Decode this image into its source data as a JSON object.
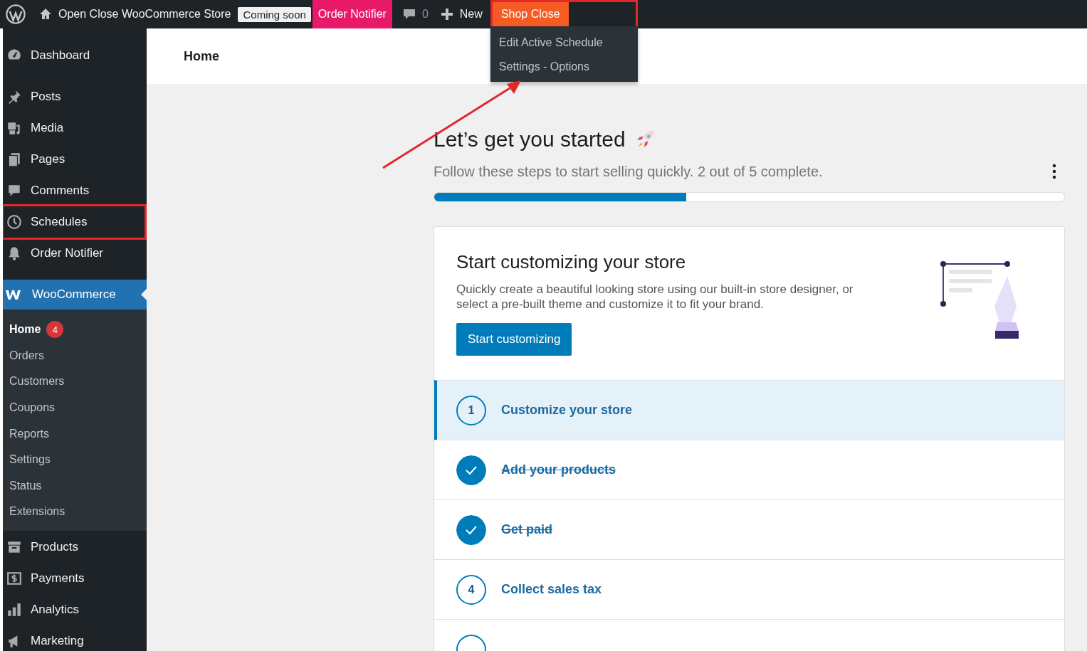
{
  "admin_bar": {
    "site_name": "Open Close WooCommerce Store",
    "status_badge": "Coming soon",
    "order_notifier": "Order Notifier",
    "comments_count": "0",
    "new_label": "New",
    "shop_menu": {
      "label": "Shop Close",
      "expanded": true,
      "highlighted": true,
      "items": [
        "Edit Active Schedule",
        "Settings - Options"
      ]
    }
  },
  "sidebar": {
    "items": [
      {
        "label": "Dashboard",
        "highlighted": false
      },
      {
        "label": "Posts",
        "highlighted": false
      },
      {
        "label": "Media",
        "highlighted": false
      },
      {
        "label": "Pages",
        "highlighted": false
      },
      {
        "label": "Comments",
        "highlighted": false
      },
      {
        "label": "Schedules",
        "highlighted": true
      },
      {
        "label": "Order Notifier",
        "highlighted": false
      }
    ],
    "current": {
      "label": "WooCommerce",
      "submenu": [
        {
          "label": "Home",
          "selected": true,
          "badge": "4"
        },
        {
          "label": "Orders",
          "selected": false
        },
        {
          "label": "Customers",
          "selected": false
        },
        {
          "label": "Coupons",
          "selected": false
        },
        {
          "label": "Reports",
          "selected": false
        },
        {
          "label": "Settings",
          "selected": false
        },
        {
          "label": "Status",
          "selected": false
        },
        {
          "label": "Extensions",
          "selected": false
        }
      ]
    },
    "items_after": [
      {
        "label": "Products"
      },
      {
        "label": "Payments"
      },
      {
        "label": "Analytics"
      },
      {
        "label": "Marketing"
      }
    ]
  },
  "header": {
    "title": "Home"
  },
  "setup": {
    "title": "Let’s get you started",
    "subtitle": "Follow these steps to start selling quickly. 2 out of 5 complete.",
    "progress": {
      "level": 0.4
    },
    "card": {
      "title": "Start customizing your store",
      "description": "Quickly create a beautiful looking store using our built-in store designer, or select a pre-built theme and customize it to fit your brand.",
      "button": "Start customizing"
    },
    "tasks": [
      {
        "number": "1",
        "label": "Customize your store",
        "done": false,
        "selected": true
      },
      {
        "label": "Add your products",
        "done": true,
        "selected": false
      },
      {
        "label": "Get paid",
        "done": true,
        "selected": false
      },
      {
        "number": "4",
        "label": "Collect sales tax",
        "done": false,
        "selected": false
      },
      {
        "done": false,
        "selected": false
      }
    ]
  }
}
